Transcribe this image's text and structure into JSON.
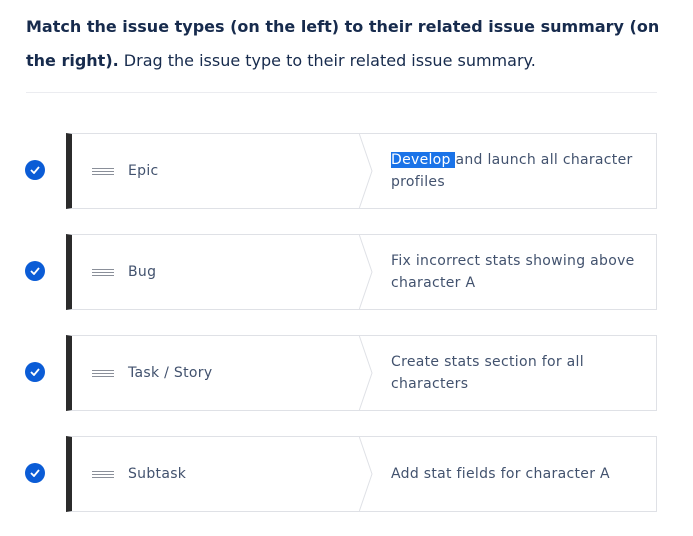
{
  "question": {
    "bold": "Match the issue types (on the left) to their related issue summary (on the right).",
    "normal": " Drag the issue type to their related issue summary."
  },
  "rows": [
    {
      "type": "Epic",
      "summary_selected": "Develop ",
      "summary": "and launch all character profiles",
      "matched": true
    },
    {
      "type": "Bug",
      "summary_selected": "",
      "summary": "Fix incorrect stats showing above character A",
      "matched": true
    },
    {
      "type": "Task / Story",
      "summary_selected": "",
      "summary": "Create stats section for all characters",
      "matched": true
    },
    {
      "type": "Subtask",
      "summary_selected": "",
      "summary": "Add stat fields for character A",
      "matched": true
    }
  ],
  "icons": {
    "check": "check-circle-icon",
    "handle": "drag-handle-icon"
  },
  "colors": {
    "accent": "#0b5cd6",
    "card_border_left": "#2b2b2b",
    "selection": "#1a73e8"
  }
}
